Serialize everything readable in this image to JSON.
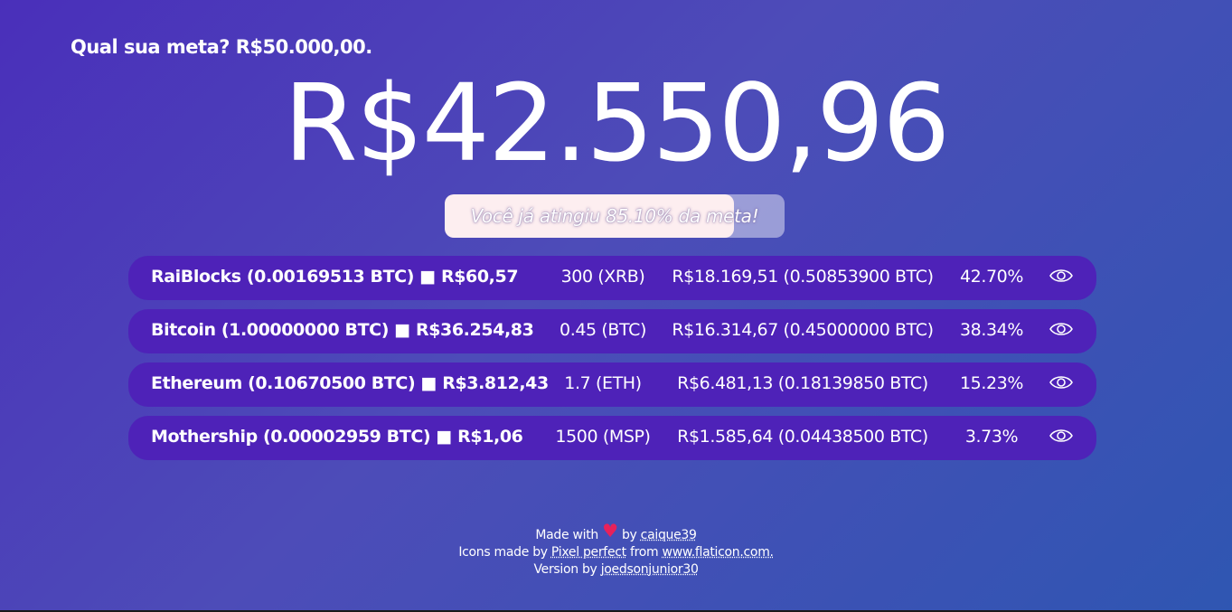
{
  "goal": {
    "text": "Qual sua meta? R$50.000,00."
  },
  "total": {
    "value": "R$42.550,96"
  },
  "progress": {
    "text": "Você já atingiu 85.10% da meta!",
    "percent": 85.1,
    "fill_color": "#fdeef0"
  },
  "coins": [
    {
      "name": "RaiBlocks (0.00169513 BTC) ■ R$60,57",
      "quantity": "300 (XRB)",
      "value": "R$18.169,51 (0.50853900 BTC)",
      "percent": "42.70%",
      "icon": "eye-icon"
    },
    {
      "name": "Bitcoin (1.00000000 BTC) ■ R$36.254,83",
      "quantity": "0.45 (BTC)",
      "value": "R$16.314,67 (0.45000000 BTC)",
      "percent": "38.34%",
      "icon": "eye-icon"
    },
    {
      "name": "Ethereum (0.10670500 BTC) ■ R$3.812,43",
      "quantity": "1.7 (ETH)",
      "value": "R$6.481,13 (0.18139850 BTC)",
      "percent": "15.23%",
      "icon": "eye-icon"
    },
    {
      "name": "Mothership (0.00002959 BTC) ■ R$1,06",
      "quantity": "1500 (MSP)",
      "value": "R$1.585,64 (0.04438500 BTC)",
      "percent": "3.73%",
      "icon": "eye-icon"
    }
  ],
  "footer": {
    "made_with": "Made with",
    "heart": "♥",
    "by": "by",
    "author": "caique39",
    "icons_made_by": "Icons made by",
    "icon_author": "Pixel perfect",
    "from": "from",
    "icon_site": "www.flaticon.com.",
    "version_by": "Version by",
    "version_author": "joedsonjunior30"
  },
  "colors": {
    "row_background": "#4e22b8",
    "heart": "#e8215a"
  }
}
